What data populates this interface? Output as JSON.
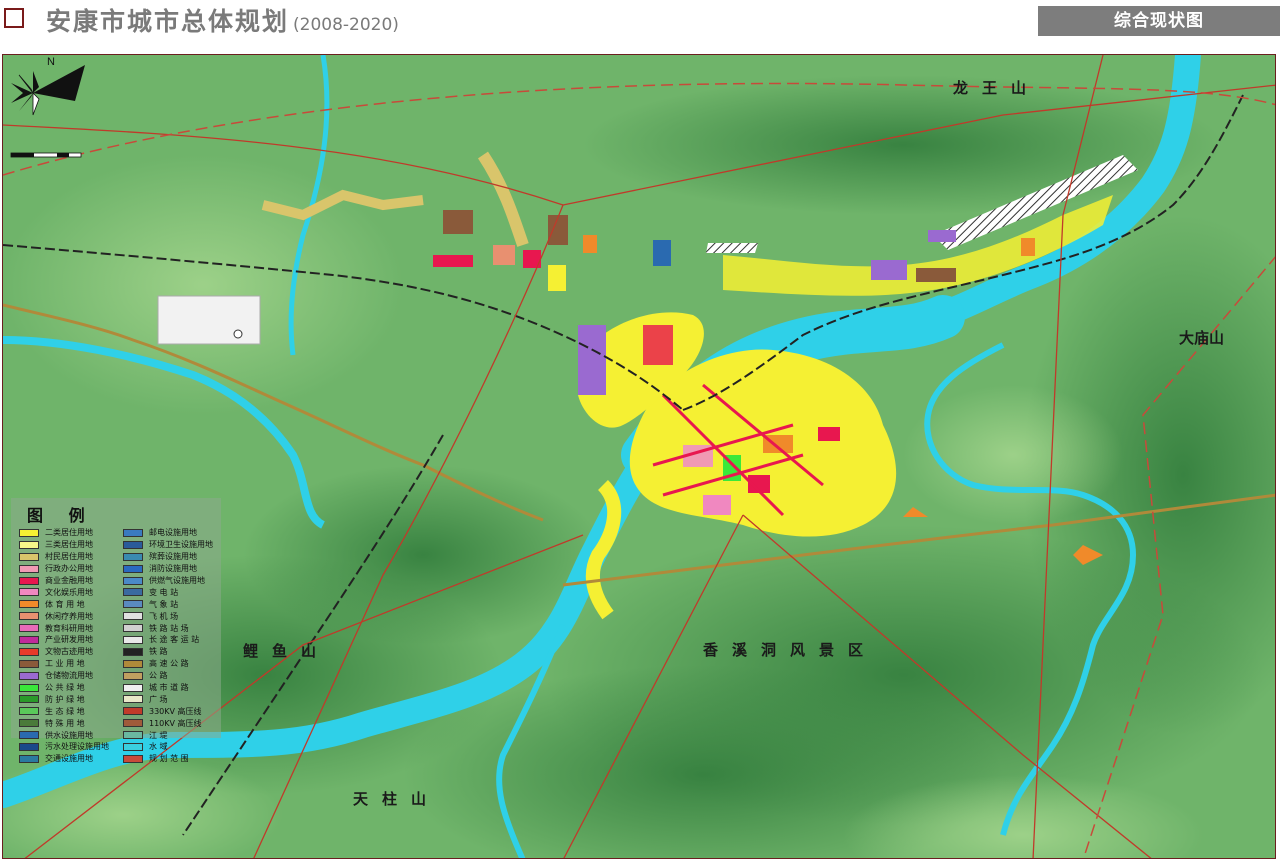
{
  "header": {
    "title": "安康市城市总体规划",
    "years": "(2008-2020)",
    "map_type": "综合现状图"
  },
  "places": {
    "longwang": "龙王山",
    "damiao": "大庙山",
    "liyu": "鲤鱼山",
    "xiangxi": "香溪洞风景区",
    "tianzhu": "天柱山"
  },
  "legend": {
    "title": "图 例",
    "left": [
      {
        "label": "二类居住用地",
        "color": "#f5f033"
      },
      {
        "label": "三类居住用地",
        "color": "#f7f78a"
      },
      {
        "label": "村民居住用地",
        "color": "#d9c56b"
      },
      {
        "label": "行政办公用地",
        "color": "#f09ab4"
      },
      {
        "label": "商业金融用地",
        "color": "#e8174f"
      },
      {
        "label": "文化娱乐用地",
        "color": "#f088c0"
      },
      {
        "label": "体 育 用 地",
        "color": "#f08a2a"
      },
      {
        "label": "休闲疗养用地",
        "color": "#e89070"
      },
      {
        "label": "教育科研用地",
        "color": "#e86ab8"
      },
      {
        "label": "产业研发用地",
        "color": "#c02a9a"
      },
      {
        "label": "文物古迹用地",
        "color": "#e83a2a"
      },
      {
        "label": "工 业 用 地",
        "color": "#8a5a3a"
      },
      {
        "label": "仓储物流用地",
        "color": "#9a6ad0"
      },
      {
        "label": "公 共 绿 地",
        "color": "#3ae83a"
      },
      {
        "label": "防 护 绿 地",
        "color": "#2a9a2a"
      },
      {
        "label": "生 态 绿 地",
        "color": "#5ac85a"
      },
      {
        "label": "特 殊 用 地",
        "color": "#4a7a3a"
      },
      {
        "label": "供水设施用地",
        "color": "#2a6ab0"
      },
      {
        "label": "污水处理设施用地",
        "color": "#1a4a8a"
      },
      {
        "label": "交通设施用地",
        "color": "#2a7aa0"
      }
    ],
    "right": [
      {
        "label": "邮电设施用地",
        "color": "#3a7ac0"
      },
      {
        "label": "环境卫生设施用地",
        "color": "#2a5a9a"
      },
      {
        "label": "殡葬设施用地",
        "color": "#3a8ab0"
      },
      {
        "label": "消防设施用地",
        "color": "#2a6ac0"
      },
      {
        "label": "供燃气设施用地",
        "color": "#4a8ac8"
      },
      {
        "label": "变 电 站",
        "color": "#3a6aa0"
      },
      {
        "label": "气 象 站",
        "color": "#5a8ac0"
      },
      {
        "label": "飞 机 场",
        "color": "#e0e0e0"
      },
      {
        "label": "铁 路 站 场",
        "color": "#d0d0d0"
      },
      {
        "label": "长 途 客 运 站",
        "color": "#e8e8e8"
      },
      {
        "label": "铁 路",
        "color": "#222222"
      },
      {
        "label": "高 速 公 路",
        "color": "#b08a3a"
      },
      {
        "label": "公 路",
        "color": "#c0a060"
      },
      {
        "label": "城 市 道 路",
        "color": "#f0f0f0"
      },
      {
        "label": "广 场",
        "color": "#e8e8c8"
      },
      {
        "label": "330KV 高压线",
        "color": "#c03a2a"
      },
      {
        "label": "110KV 高压线",
        "color": "#a05a3a"
      },
      {
        "label": "江 堤",
        "color": "#6ab8a0"
      },
      {
        "label": "水 域",
        "color": "#3ad0e0"
      },
      {
        "label": "规 划 范 围",
        "color": "#c84a3a"
      }
    ]
  },
  "colors": {
    "river": "#2fd0e8",
    "terrain_light": "#7fc07a",
    "terrain_dark": "#3f8a4a",
    "residential": "#f5f033",
    "frame": "#6a1f1f"
  }
}
